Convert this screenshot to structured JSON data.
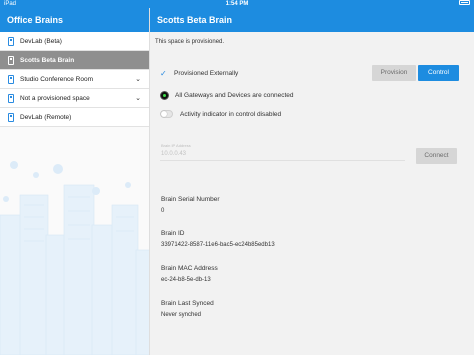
{
  "status_bar": {
    "carrier": "iPad",
    "time": "1:54 PM",
    "battery": "100%"
  },
  "sidebar": {
    "title": "Office Brains",
    "items": [
      {
        "label": "DevLab (Beta)",
        "icon": "device-icon",
        "selected": false
      },
      {
        "label": "Scotts Beta Brain",
        "icon": "device-icon",
        "selected": true
      },
      {
        "label": "Studio Conference Room",
        "icon": "chevron-down-icon",
        "selected": false
      },
      {
        "label": "Not a provisioned space",
        "icon": "chevron-down-icon",
        "selected": false
      },
      {
        "label": "DevLab (Remote)",
        "icon": "device-icon",
        "selected": false
      }
    ]
  },
  "main": {
    "title": "Scotts Beta Brain",
    "provisioned_text": "This space is provisioned.",
    "provisioned_externally": "Provisioned Externally",
    "gateways_status": "All Gateways and Devices are connected",
    "activity_indicator": "Activity indicator in control disabled",
    "buttons": {
      "provision": "Provision",
      "control": "Control",
      "connect": "Connect"
    },
    "ip_field": {
      "label": "Brain IP Address",
      "value": "10.0.0.43"
    },
    "info": {
      "serial_label": "Brain Serial Number",
      "serial_value": "0",
      "id_label": "Brain ID",
      "id_value": "33971422-8587-11e6-bac5-ec24b85edb13",
      "mac_label": "Brain MAC Address",
      "mac_value": "ec-24-b8-5e-db-13",
      "synced_label": "Brain Last Synced",
      "synced_value": "Never synched"
    }
  },
  "colors": {
    "accent": "#1d8ce0",
    "selected_row": "#8f8f8f",
    "status_ok": "#3edc4a"
  }
}
